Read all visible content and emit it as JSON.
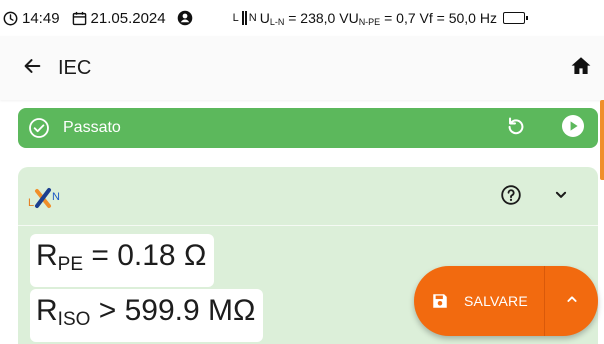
{
  "status_bar": {
    "time": "14:49",
    "date": "21.05.2024",
    "phase_l": "L",
    "phase_n": "N",
    "u_ln_label": "U",
    "u_ln_sub": "L-N",
    "u_ln_value": " = 238,0 V ",
    "u_npe_label": "U",
    "u_npe_sub": "N-PE",
    "u_npe_value": " = 0,7 V ",
    "freq": "f = 50,0 Hz",
    "icons": [
      "clock-icon",
      "calendar-icon",
      "user-icon",
      "battery-icon"
    ]
  },
  "app_bar": {
    "title": "IEC",
    "icons": [
      "arrow-back-icon",
      "home-icon"
    ]
  },
  "result": {
    "label": "Passato",
    "status": "passed",
    "color": "#5cb85c",
    "icons": [
      "check-circle-icon",
      "retry-icon",
      "play-icon"
    ]
  },
  "measurement_card": {
    "logo_l": "L",
    "logo_n": "N",
    "icons": [
      "lxn-logo-icon",
      "help-icon",
      "chevron-down-icon"
    ],
    "rpe": {
      "symbol": "R",
      "sub": "PE",
      "value": " = 0.18 Ω"
    },
    "riso": {
      "symbol": "R",
      "sub": "ISO",
      "value": " > 599.9 MΩ"
    }
  },
  "save_button": {
    "label": "SALVARE",
    "color": "#f26a0f",
    "icons": [
      "save-icon",
      "chevron-up-icon"
    ]
  },
  "colors": {
    "accent": "#f08f2a",
    "card_bg": "#dcefd9",
    "pass_green": "#5cb85c"
  }
}
